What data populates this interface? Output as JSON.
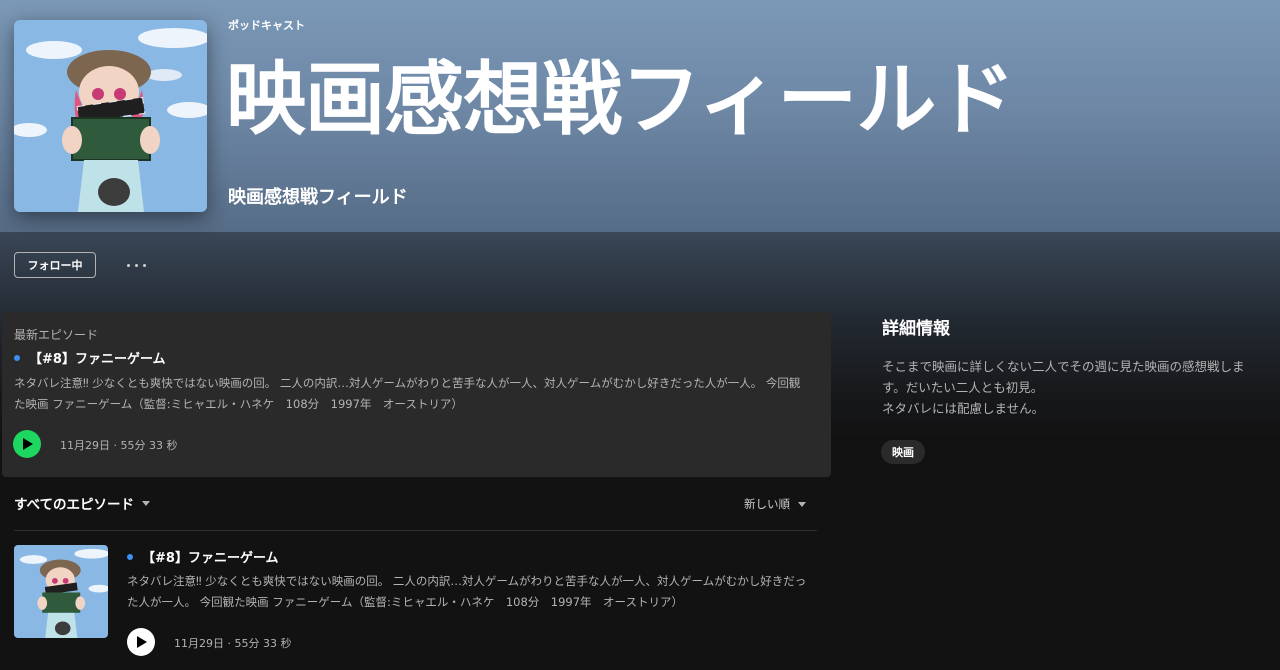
{
  "header": {
    "kind": "ポッドキャスト",
    "title": "映画感想戦フィールド",
    "author": "映画感想戦フィールド"
  },
  "actions": {
    "follow_label": "フォロー中",
    "more_icon": "more-horizontal-icon"
  },
  "latest_episode": {
    "section_label": "最新エピソード",
    "title": "【#8】ファニーゲーム",
    "description_line1": "ネタバレ注意‼ 少なくとも爽快ではない映画の回。 二人の内訳…対人ゲームがわりと苦手な人が一人、対人ゲームがむかし好きだった人が一人。 今回観",
    "description_line2": "た映画 ファニーゲーム（監督:ミヒャエル・ハネケ　108分　1997年　オーストリア）",
    "meta": "11月29日 · 55分 33 秒"
  },
  "episodes_header": {
    "label": "すべてのエピソード",
    "sort_label": "新しい順"
  },
  "episodes": [
    {
      "title": "【#8】ファニーゲーム",
      "description_line1": "ネタバレ注意‼ 少なくとも爽快ではない映画の回。 二人の内訳…対人ゲームがわりと苦手な人が一人、対人ゲームがむかし好きだっ",
      "description_line2": "た人が一人。 今回観た映画 ファニーゲーム（監督:ミヒャエル・ハネケ　108分　1997年　オーストリア）",
      "meta": "11月29日 · 55分 33 秒"
    }
  ],
  "details": {
    "heading": "詳細情報",
    "line1": "そこまで映画に詳しくない二人でその週に見た映画の感想戦しま",
    "line2": "す。だいたい二人とも初見。",
    "line3": "ネタバレには配慮しません。",
    "tag": "映画"
  },
  "colors": {
    "accent_green": "#1ed760",
    "new_dot_blue": "#3d91f4",
    "background": "#121212",
    "card": "#2a2a2a"
  }
}
